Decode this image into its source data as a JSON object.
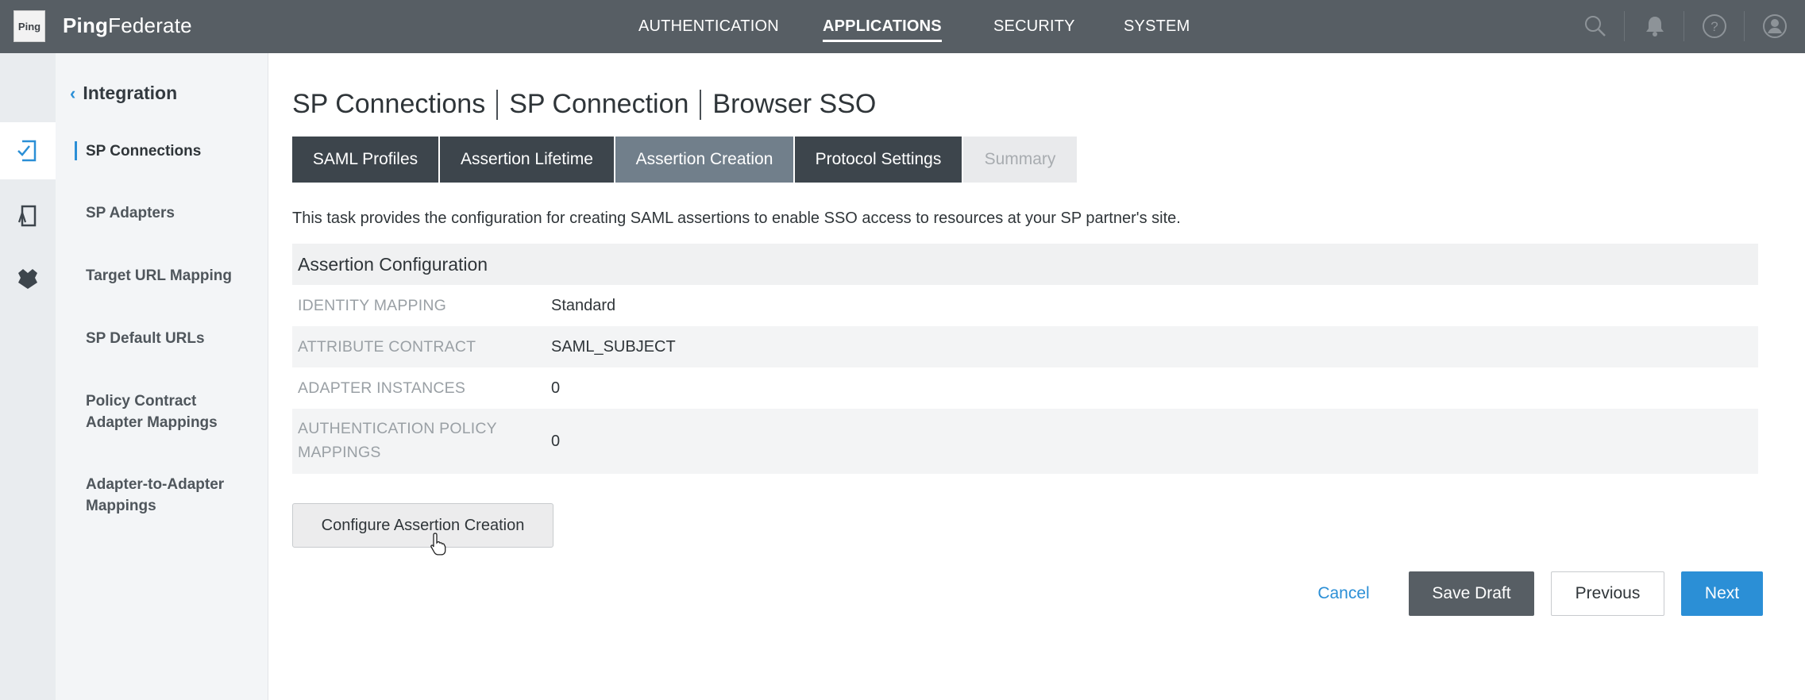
{
  "header": {
    "logo_text": "Ping",
    "brand_bold": "Ping",
    "brand_light": "Federate",
    "nav": [
      {
        "label": "AUTHENTICATION"
      },
      {
        "label": "APPLICATIONS",
        "active": true
      },
      {
        "label": "SECURITY"
      },
      {
        "label": "SYSTEM"
      }
    ],
    "icons": [
      "search-icon",
      "bell-icon",
      "help-icon",
      "user-icon"
    ]
  },
  "rail": {
    "icons": [
      "sp-connections-icon",
      "sp-adapters-icon",
      "idp-icon"
    ]
  },
  "sidebar": {
    "back_label": "Integration",
    "items": [
      {
        "label": "SP Connections",
        "active": true
      },
      {
        "label": "SP Adapters"
      },
      {
        "label": "Target URL Mapping"
      },
      {
        "label": "SP Default URLs"
      },
      {
        "label": "Policy Contract Adapter Mappings"
      },
      {
        "label": "Adapter-to-Adapter Mappings"
      }
    ]
  },
  "page": {
    "breadcrumb": [
      "SP Connections",
      "SP Connection",
      "Browser SSO"
    ],
    "tabs": [
      {
        "label": "SAML Profiles"
      },
      {
        "label": "Assertion Lifetime"
      },
      {
        "label": "Assertion Creation",
        "current": true
      },
      {
        "label": "Protocol Settings"
      },
      {
        "label": "Summary",
        "disabled": true
      }
    ],
    "description": "This task provides the configuration for creating SAML assertions to enable SSO access to resources at your SP partner's site.",
    "config": {
      "title": "Assertion Configuration",
      "rows": [
        {
          "label": "IDENTITY MAPPING",
          "value": "Standard"
        },
        {
          "label": "ATTRIBUTE CONTRACT",
          "value": "SAML_SUBJECT"
        },
        {
          "label": "ADAPTER INSTANCES",
          "value": "0"
        },
        {
          "label": "AUTHENTICATION POLICY MAPPINGS",
          "value": "0"
        }
      ]
    },
    "configure_button": "Configure Assertion Creation"
  },
  "footer": {
    "cancel": "Cancel",
    "save_draft": "Save Draft",
    "previous": "Previous",
    "next": "Next"
  },
  "colors": {
    "topbar": "#575e64",
    "accent": "#2b8fd6",
    "tab_dark": "#3d454c",
    "tab_current": "#717f8b"
  }
}
